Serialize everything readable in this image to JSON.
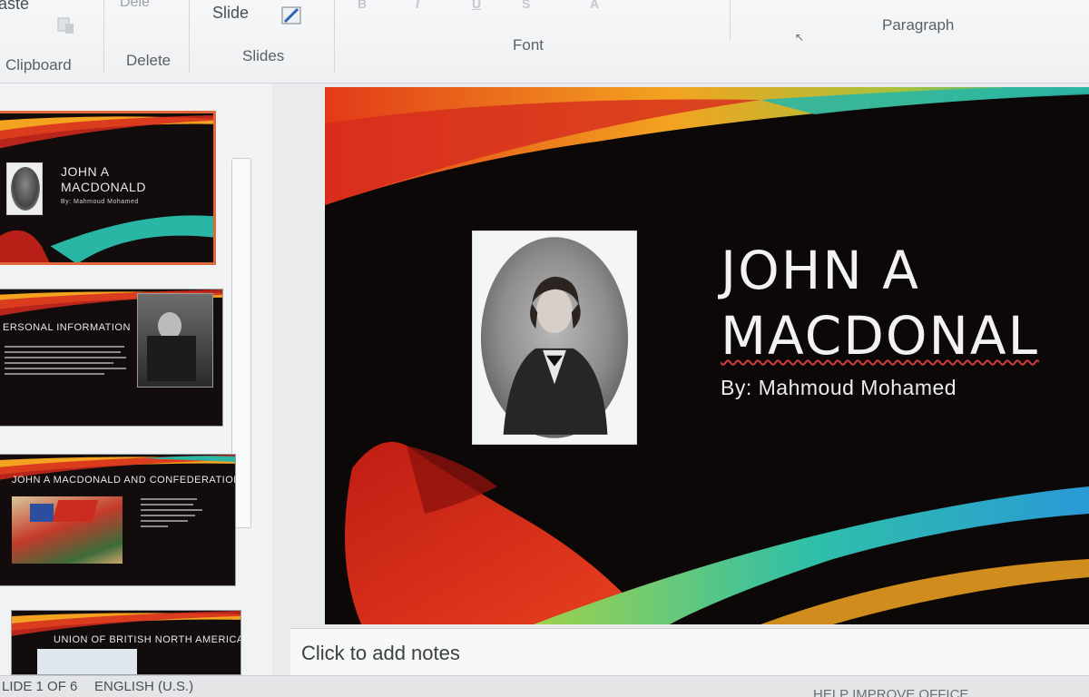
{
  "ribbon": {
    "paste_label": "aste",
    "delete_button_label": "Dele",
    "new_slide_label": "Slide",
    "groups": {
      "clipboard": "Clipboard",
      "delete": "Delete",
      "slides": "Slides",
      "font": "Font",
      "paragraph": "Paragraph"
    }
  },
  "thumbnails": [
    {
      "title": "JOHN A MACDONALD",
      "subtitle": "By: Mahmoud Mohamed",
      "selected": true
    },
    {
      "title": "ERSONAL INFORMATION"
    },
    {
      "title": "JOHN A MACDONALD AND CONFEDERATION"
    },
    {
      "title": "UNION OF BRITISH NORTH AMERICA"
    }
  ],
  "slide": {
    "title_line1": "JOHN A",
    "title_line2": "MACDONAL",
    "subtitle": "By: Mahmoud Mohamed"
  },
  "notes": {
    "placeholder": "Click to add notes"
  },
  "status": {
    "slide_counter": "LIDE 1 OF 6",
    "language": "ENGLISH (U.S.)",
    "help_improve": "HELP IMPROVE OFFICE"
  },
  "colors": {
    "selection_border": "#e0683a",
    "slide_background": "#0d0808",
    "swoosh_red": "#d62a1e",
    "swoosh_orange": "#f3a320",
    "swoosh_teal": "#2ab6a4",
    "spellcheck_underline": "#d23c3c"
  }
}
